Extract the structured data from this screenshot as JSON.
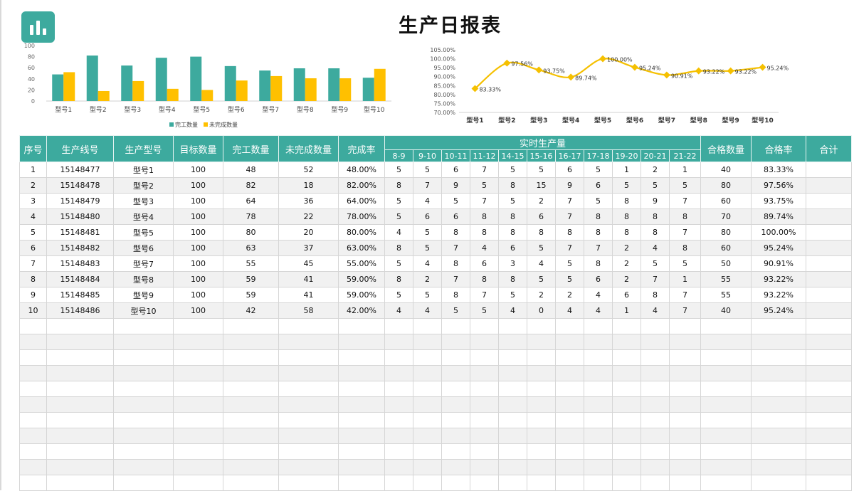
{
  "report": {
    "title": "生产日报表"
  },
  "colors": {
    "accent": "#3daa9e",
    "series_done": "#3daa9e",
    "series_undone": "#ffc000",
    "line": "#f5c000"
  },
  "icons": {
    "logo": "bar-chart-icon"
  },
  "chart_data": [
    {
      "type": "bar",
      "categories": [
        "型号1",
        "型号2",
        "型号3",
        "型号4",
        "型号5",
        "型号6",
        "型号7",
        "型号8",
        "型号9",
        "型号10"
      ],
      "series": [
        {
          "name": "完工数量",
          "values": [
            48,
            82,
            64,
            78,
            80,
            63,
            55,
            59,
            59,
            42
          ]
        },
        {
          "name": "未完成数量",
          "values": [
            52,
            18,
            36,
            22,
            20,
            37,
            45,
            41,
            41,
            58
          ]
        }
      ],
      "yticks": [
        "0",
        "20",
        "40",
        "60",
        "80",
        "100"
      ],
      "ylim": [
        0,
        100
      ],
      "legend": "bottom"
    },
    {
      "type": "line",
      "categories": [
        "型号1",
        "型号2",
        "型号3",
        "型号4",
        "型号5",
        "型号6",
        "型号7",
        "型号8",
        "型号9",
        "型号10"
      ],
      "values": [
        83.33,
        97.56,
        93.75,
        89.74,
        100.0,
        95.24,
        90.91,
        93.22,
        93.22,
        95.24
      ],
      "labels": [
        "83.33%",
        "97.56%",
        "93.75%",
        "89.74%",
        "100.00%",
        "95.24%",
        "90.91%",
        "93.22%",
        "93.22%",
        "95.24%"
      ],
      "yticks": [
        "70.00%",
        "75.00%",
        "80.00%",
        "85.00%",
        "90.00%",
        "95.00%",
        "100.00%",
        "105.00%"
      ],
      "ylim": [
        70,
        105
      ]
    }
  ],
  "table": {
    "headers": {
      "seq": "序号",
      "line": "生产线号",
      "model": "生产型号",
      "target": "目标数量",
      "done": "完工数量",
      "undone": "未完成数量",
      "rate": "完成率",
      "realtime": "实时生产量",
      "pass_qty": "合格数量",
      "pass_rate": "合格率",
      "total": "合计"
    },
    "slots": [
      "8-9",
      "9-10",
      "10-11",
      "11-12",
      "14-15",
      "15-16",
      "16-17",
      "17-18",
      "19-20",
      "20-21",
      "21-22"
    ],
    "rows": [
      [
        "1",
        "15148477",
        "型号1",
        "100",
        "48",
        "52",
        "48.00%",
        "5",
        "5",
        "6",
        "7",
        "5",
        "5",
        "6",
        "5",
        "1",
        "2",
        "1",
        "40",
        "83.33%",
        ""
      ],
      [
        "2",
        "15148478",
        "型号2",
        "100",
        "82",
        "18",
        "82.00%",
        "8",
        "7",
        "9",
        "5",
        "8",
        "15",
        "9",
        "6",
        "5",
        "5",
        "5",
        "80",
        "97.56%",
        ""
      ],
      [
        "3",
        "15148479",
        "型号3",
        "100",
        "64",
        "36",
        "64.00%",
        "5",
        "4",
        "5",
        "7",
        "5",
        "2",
        "7",
        "5",
        "8",
        "9",
        "7",
        "60",
        "93.75%",
        ""
      ],
      [
        "4",
        "15148480",
        "型号4",
        "100",
        "78",
        "22",
        "78.00%",
        "5",
        "6",
        "6",
        "8",
        "8",
        "6",
        "7",
        "8",
        "8",
        "8",
        "8",
        "70",
        "89.74%",
        ""
      ],
      [
        "5",
        "15148481",
        "型号5",
        "100",
        "80",
        "20",
        "80.00%",
        "4",
        "5",
        "8",
        "8",
        "8",
        "8",
        "8",
        "8",
        "8",
        "8",
        "7",
        "80",
        "100.00%",
        ""
      ],
      [
        "6",
        "15148482",
        "型号6",
        "100",
        "63",
        "37",
        "63.00%",
        "8",
        "5",
        "7",
        "4",
        "6",
        "5",
        "7",
        "7",
        "2",
        "4",
        "8",
        "60",
        "95.24%",
        ""
      ],
      [
        "7",
        "15148483",
        "型号7",
        "100",
        "55",
        "45",
        "55.00%",
        "5",
        "4",
        "8",
        "6",
        "3",
        "4",
        "5",
        "8",
        "2",
        "5",
        "5",
        "50",
        "90.91%",
        ""
      ],
      [
        "8",
        "15148484",
        "型号8",
        "100",
        "59",
        "41",
        "59.00%",
        "8",
        "2",
        "7",
        "8",
        "8",
        "5",
        "5",
        "6",
        "2",
        "7",
        "1",
        "55",
        "93.22%",
        ""
      ],
      [
        "9",
        "15148485",
        "型号9",
        "100",
        "59",
        "41",
        "59.00%",
        "5",
        "5",
        "8",
        "7",
        "5",
        "2",
        "2",
        "4",
        "6",
        "8",
        "7",
        "55",
        "93.22%",
        ""
      ],
      [
        "10",
        "15148486",
        "型号10",
        "100",
        "42",
        "58",
        "42.00%",
        "4",
        "4",
        "5",
        "5",
        "4",
        "0",
        "4",
        "4",
        "1",
        "4",
        "7",
        "40",
        "95.24%",
        ""
      ]
    ],
    "blank_rows": 11
  }
}
